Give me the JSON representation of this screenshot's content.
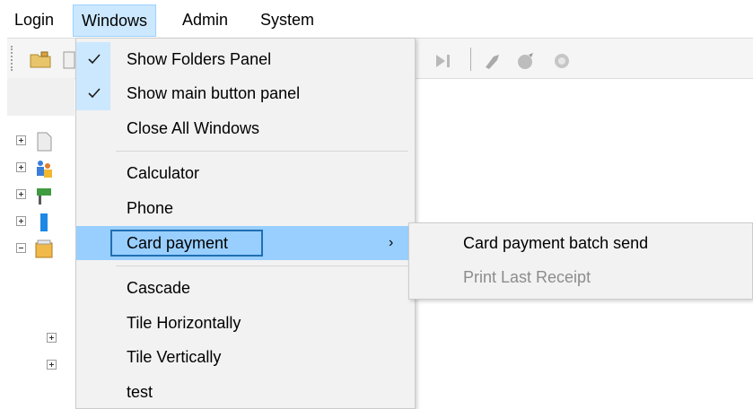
{
  "menubar": {
    "items": [
      {
        "label": "Login"
      },
      {
        "label": "Windows"
      },
      {
        "label": "Admin"
      },
      {
        "label": "System"
      }
    ]
  },
  "windows_menu": {
    "items": [
      {
        "label": "Show Folders Panel",
        "checked": true
      },
      {
        "label": "Show main button panel",
        "checked": true
      },
      {
        "label": "Close All Windows",
        "checked": false
      },
      {
        "label": "Calculator",
        "checked": false
      },
      {
        "label": "Phone",
        "checked": false
      },
      {
        "label": "Card payment",
        "checked": false,
        "has_submenu": true,
        "highlighted": true
      },
      {
        "label": "Cascade",
        "checked": false
      },
      {
        "label": "Tile Horizontally",
        "checked": false
      },
      {
        "label": "Tile Vertically",
        "checked": false
      },
      {
        "label": "test",
        "checked": false
      }
    ],
    "submenu_arrow": "›"
  },
  "card_payment_submenu": {
    "items": [
      {
        "label": "Card payment batch send",
        "enabled": true
      },
      {
        "label": "Print Last Receipt",
        "enabled": false
      }
    ]
  },
  "tree": {
    "nodes": [
      {
        "expander": "plus",
        "icon": "document-icon"
      },
      {
        "expander": "plus",
        "icon": "people-icon"
      },
      {
        "expander": "plus",
        "icon": "sign-icon"
      },
      {
        "expander": "plus",
        "icon": "blue-bar-icon"
      },
      {
        "expander": "minus",
        "icon": "cabinet-icon"
      },
      {
        "expander": "plus",
        "icon": ""
      },
      {
        "expander": "plus",
        "icon": ""
      }
    ]
  },
  "colors": {
    "menu_highlight": "#99cfff",
    "menubar_selected": "#cce8ff",
    "check_column": "#cce8ff",
    "focus_border": "#1f6fb2",
    "disabled_text": "#8c8c8c"
  }
}
